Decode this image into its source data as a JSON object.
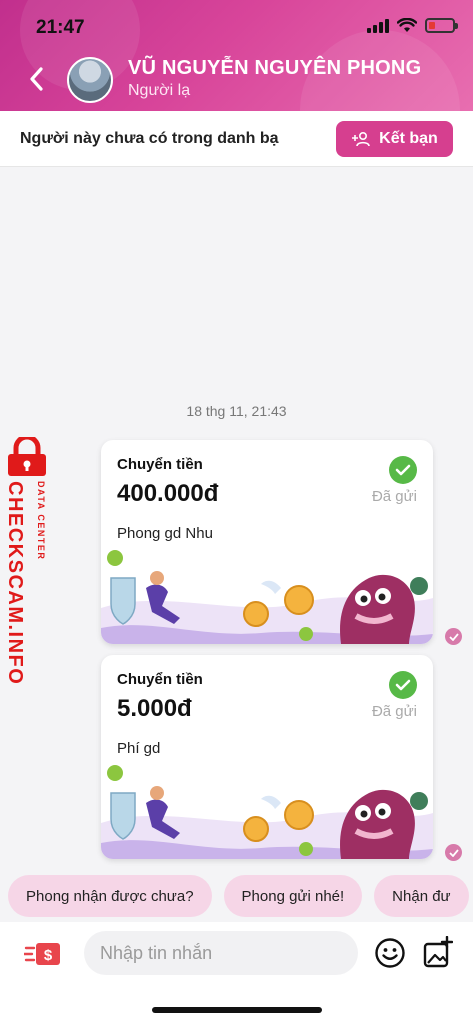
{
  "status_bar": {
    "time": "21:47"
  },
  "header": {
    "contact_name": "VŨ NGUYỄN NGUYÊN PHONG",
    "contact_status": "Người lạ"
  },
  "banner": {
    "text": "Người này chưa có trong danh bạ",
    "add_friend_label": "Kết bạn"
  },
  "chat": {
    "date_label": "18 thg 11, 21:43",
    "messages": [
      {
        "title": "Chuyển tiền",
        "amount": "400.000đ",
        "note": "Phong gd Nhu",
        "status": "Đã gửi"
      },
      {
        "title": "Chuyển tiền",
        "amount": "5.000đ",
        "note": "Phí gd",
        "status": "Đã gửi"
      }
    ]
  },
  "watermark": {
    "main": "CHECKSCAM.INFO",
    "sub": "DATA CENTER"
  },
  "quick_replies": [
    "Phong nhận được chưa?",
    "Phong gửi nhé!",
    "Nhận đư"
  ],
  "composer": {
    "placeholder": "Nhập tin nhắn"
  },
  "colors": {
    "brand": "#d63f8f",
    "check": "#57b947",
    "chip": "#f6d6e7",
    "watermark": "#e01a1a"
  },
  "icons": [
    "back-arrow-icon",
    "add-person-icon",
    "check-icon",
    "money-transfer-icon",
    "emoji-icon",
    "add-image-icon",
    "lock-icon"
  ]
}
